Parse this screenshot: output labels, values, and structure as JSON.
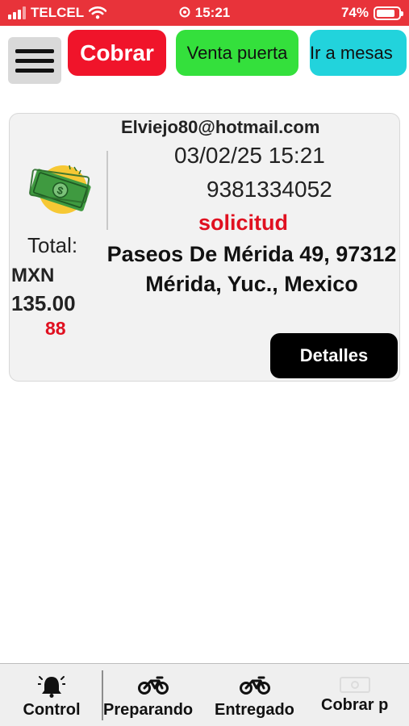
{
  "status_bar": {
    "carrier": "TELCEL",
    "time": "15:21",
    "battery": "74%",
    "battery_level": 0.74,
    "icons": [
      "signal-icon",
      "wifi-icon",
      "alarm-icon",
      "battery-icon"
    ]
  },
  "top_nav": {
    "menu_icon": "hamburger-menu-icon",
    "cobrar_label": "Cobrar",
    "venta_label": "Venta puerta",
    "mesas_label": "Ir a mesas",
    "colors": {
      "cobrar": "#f0142a",
      "venta": "#34e03c",
      "mesas": "#22d3dc"
    }
  },
  "order": {
    "icon": "money-icon",
    "total_label": "Total:",
    "currency": "MXN",
    "amount": "135.00",
    "number": "88",
    "email": "Elviejo80@hotmail.com",
    "datetime": "03/02/25 15:21",
    "phone": "9381334052",
    "status": "solicitud",
    "address": "Paseos De Mérida 49, 97312 Mérida, Yuc., Mexico",
    "details_label": "Detalles"
  },
  "tab_bar": {
    "tabs": [
      {
        "label": "Control",
        "icon": "bell-icon"
      },
      {
        "label": "Preparando",
        "icon": "motorcycle-icon"
      },
      {
        "label": "Entregado",
        "icon": "motorcycle-icon"
      },
      {
        "label": "Cobrar p",
        "icon": "cash-icon"
      }
    ]
  }
}
